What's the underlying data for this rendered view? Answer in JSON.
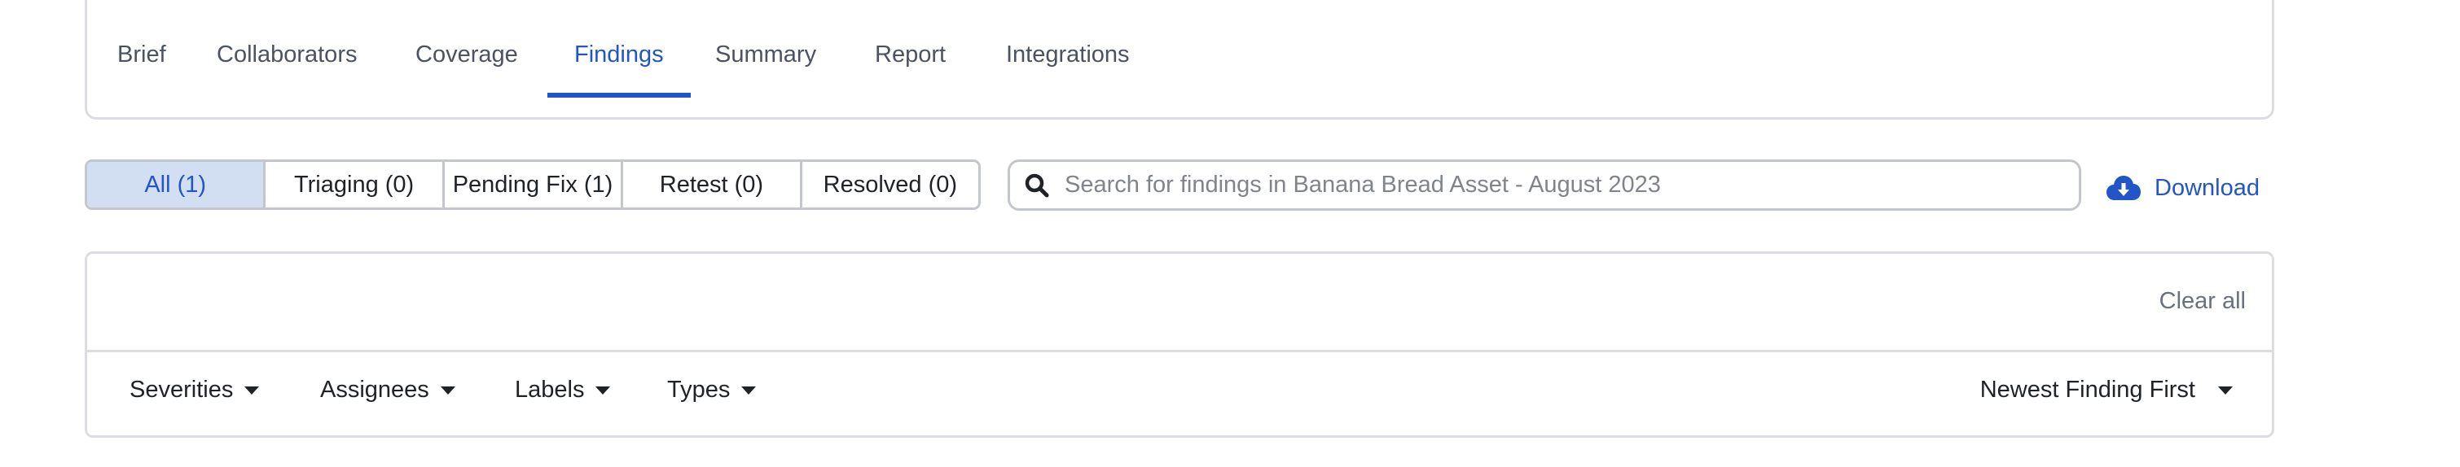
{
  "tabs": {
    "items": [
      {
        "label": "Brief",
        "active": false
      },
      {
        "label": "Collaborators",
        "active": false
      },
      {
        "label": "Coverage",
        "active": false
      },
      {
        "label": "Findings",
        "active": true
      },
      {
        "label": "Summary",
        "active": false
      },
      {
        "label": "Report",
        "active": false
      },
      {
        "label": "Integrations",
        "active": false
      }
    ]
  },
  "status_filter": {
    "items": [
      {
        "label": "All (1)",
        "active": true
      },
      {
        "label": "Triaging (0)",
        "active": false
      },
      {
        "label": "Pending Fix (1)",
        "active": false
      },
      {
        "label": "Retest (0)",
        "active": false
      },
      {
        "label": "Resolved (0)",
        "active": false
      }
    ]
  },
  "search": {
    "placeholder": "Search for findings in Banana Bread Asset - August 2023",
    "value": "",
    "icon": "search-icon"
  },
  "download": {
    "label": "Download",
    "icon": "cloud-download-icon"
  },
  "filters": {
    "clear_all_label": "Clear all",
    "dropdowns": [
      {
        "label": "Severities"
      },
      {
        "label": "Assignees"
      },
      {
        "label": "Labels"
      },
      {
        "label": "Types"
      }
    ],
    "sort": {
      "label": "Newest Finding First"
    }
  },
  "colors": {
    "accent": "#2255c8",
    "active_segment_bg": "#d2dff3",
    "border": "#c3c7cd",
    "card_border": "#dcdde2",
    "muted_text": "#6a717d"
  }
}
